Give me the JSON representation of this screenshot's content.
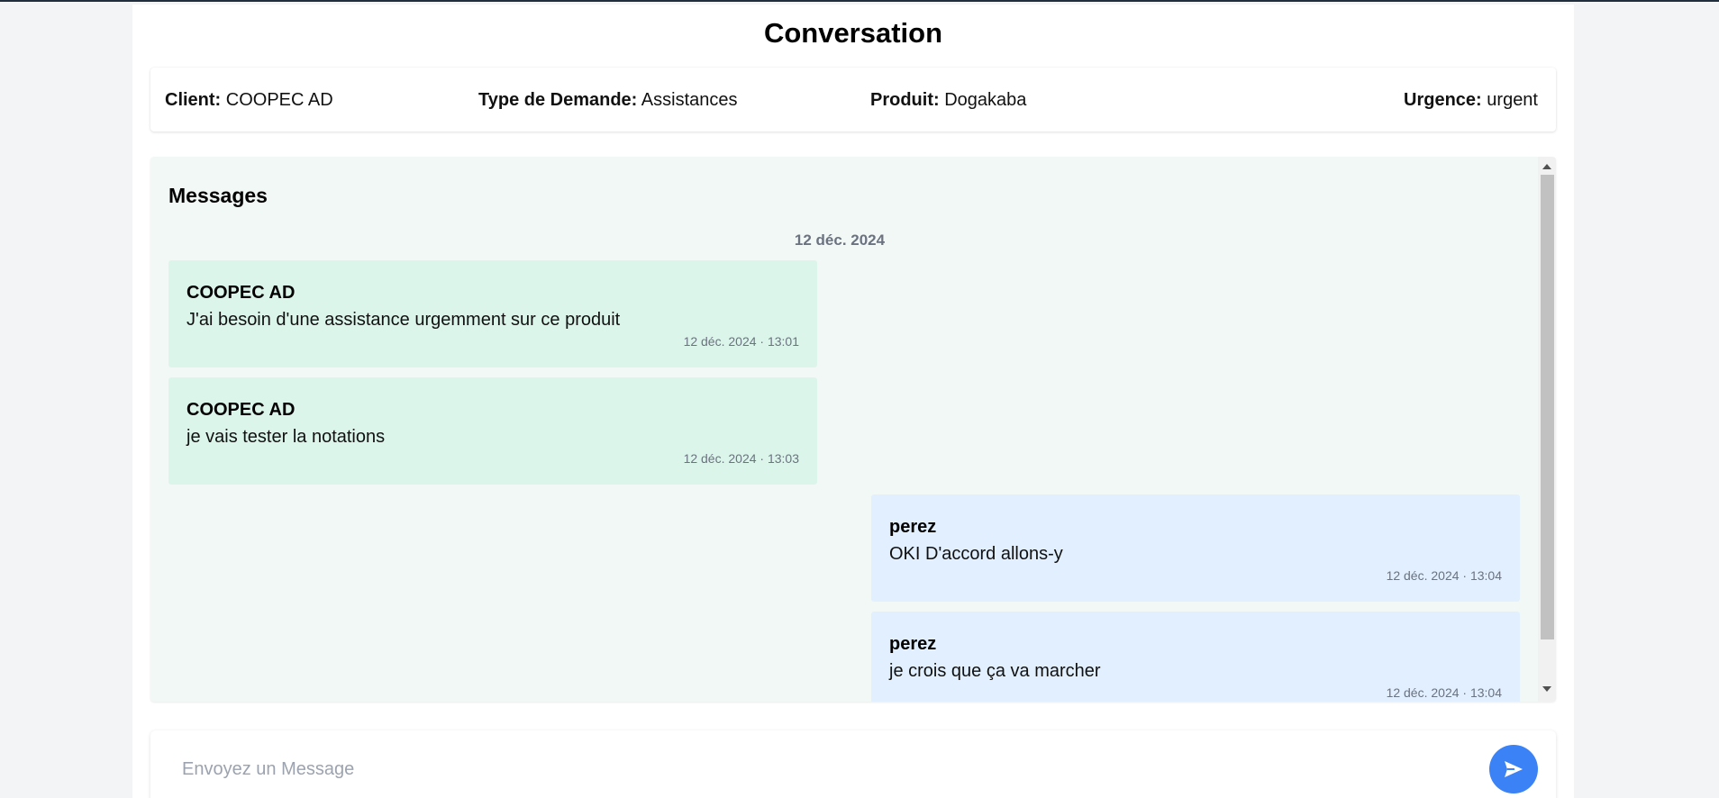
{
  "page": {
    "title": "Conversation"
  },
  "info": {
    "client_label": "Client:",
    "client_value": "COOPEC AD",
    "type_label": "Type de Demande:",
    "type_value": "Assistances",
    "product_label": "Produit:",
    "product_value": "Dogakaba",
    "urgency_label": "Urgence:",
    "urgency_value": "urgent"
  },
  "messages": {
    "heading": "Messages",
    "date_separator": "12 déc. 2024",
    "items": [
      {
        "author": "COOPEC AD",
        "text": "J'ai besoin d'une assistance urgemment sur ce produit",
        "time": "12 déc. 2024 · 13:01",
        "side": "client"
      },
      {
        "author": "COOPEC AD",
        "text": "je vais tester la notations",
        "time": "12 déc. 2024 · 13:03",
        "side": "client"
      },
      {
        "author": "perez",
        "text": "OKI D'accord allons-y",
        "time": "12 déc. 2024 · 13:04",
        "side": "agent"
      },
      {
        "author": "perez",
        "text": "je crois que ça va marcher",
        "time": "12 déc. 2024 · 13:04",
        "side": "agent"
      }
    ]
  },
  "composer": {
    "placeholder": "Envoyez un Message",
    "value": "",
    "send_icon": "send-icon"
  },
  "colors": {
    "client_bubble": "#dcf5eb",
    "agent_bubble": "#e1effe",
    "accent": "#3b82f6"
  }
}
